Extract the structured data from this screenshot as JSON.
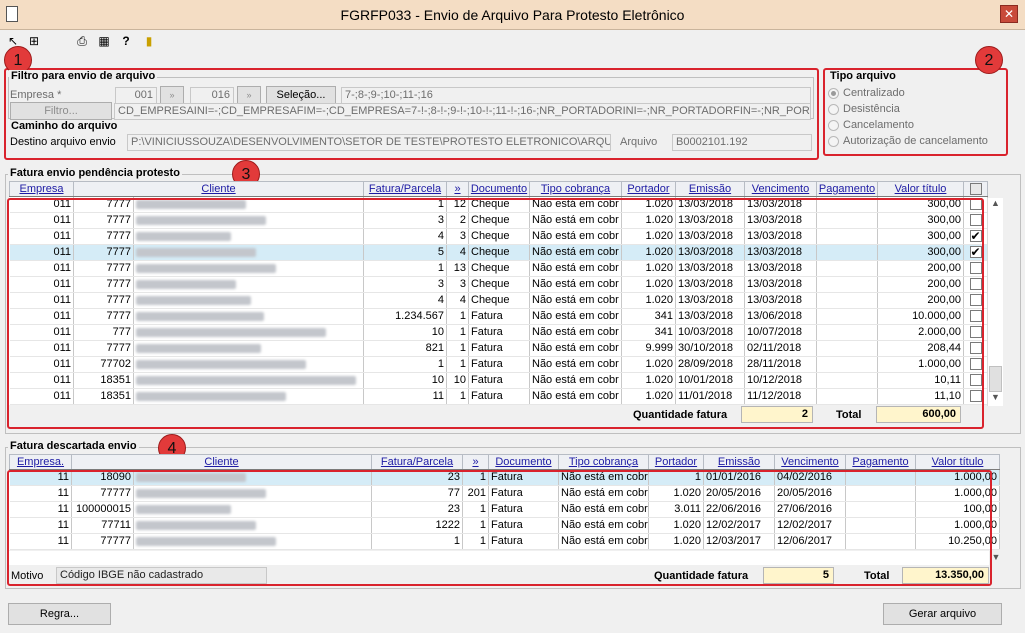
{
  "window": {
    "title": "FGRFP033 - Envio de Arquivo Para Protesto Eletrônico",
    "close_label": "✕"
  },
  "toolbar": {
    "icons": [
      "select-arrow-icon",
      "tree-icon",
      "print-icon",
      "grid-icon",
      "help-icon",
      "exit-door-icon"
    ]
  },
  "badges": [
    "1",
    "2",
    "3",
    "4"
  ],
  "filter": {
    "title": "Filtro para envio de arquivo",
    "empresa_label": "Empresa *",
    "empresa_from": "001",
    "empresa_to": "016",
    "selecao_button": "Seleção...",
    "selecao_value": "7-;8-;9-;10-;11-;16",
    "filtro_button": "Filtro...",
    "filtro_value": "CD_EMPRESAINI=-;CD_EMPRESAFIM=-;CD_EMPRESA=7-!-;8-!-;9-!-;10-!-;11-!-;16-;NR_PORTADORINI=-;NR_PORTADORFIN=-;NR_PORTADOR=-;NR_"
  },
  "path": {
    "title": "Caminho do arquivo",
    "destino_label": "Destino arquivo envio",
    "destino_value": "P:\\VINICIUSSOUZA\\DESENVOLVIMENTO\\SETOR DE TESTE\\PROTESTO ELETRONICO\\ARQUIVOS_GE",
    "arquivo_label": "Arquivo",
    "arquivo_value": "B0002101.192"
  },
  "tipo": {
    "title": "Tipo arquivo",
    "options": [
      "Centralizado",
      "Desistência",
      "Cancelamento",
      "Autorização de cancelamento"
    ],
    "selected": "Centralizado"
  },
  "pending": {
    "title": "Fatura envio pendência protesto",
    "headers": [
      "Empresa",
      "Cliente",
      "Fatura/Parcela",
      "»",
      "Documento",
      "Tipo cobrança",
      "Portador",
      "Emissão",
      "Vencimento",
      "Pagamento",
      "Valor título",
      ""
    ],
    "rows": [
      {
        "empresa": "011",
        "cliente": "7777",
        "fatura": "1",
        "parcela": "12",
        "documento": "Cheque",
        "tipo": "Não está em cobr",
        "portador": "1.020",
        "emissao": "13/03/2018",
        "vencimento": "13/03/2018",
        "pagamento": "",
        "valor": "300,00",
        "checked": false
      },
      {
        "empresa": "011",
        "cliente": "7777",
        "fatura": "3",
        "parcela": "2",
        "documento": "Cheque",
        "tipo": "Não está em cobr",
        "portador": "1.020",
        "emissao": "13/03/2018",
        "vencimento": "13/03/2018",
        "pagamento": "",
        "valor": "300,00",
        "checked": false
      },
      {
        "empresa": "011",
        "cliente": "7777",
        "fatura": "4",
        "parcela": "3",
        "documento": "Cheque",
        "tipo": "Não está em cobr",
        "portador": "1.020",
        "emissao": "13/03/2018",
        "vencimento": "13/03/2018",
        "pagamento": "",
        "valor": "300,00",
        "checked": true
      },
      {
        "empresa": "011",
        "cliente": "7777",
        "fatura": "5",
        "parcela": "4",
        "documento": "Cheque",
        "tipo": "Não está em cobr",
        "portador": "1.020",
        "emissao": "13/03/2018",
        "vencimento": "13/03/2018",
        "pagamento": "",
        "valor": "300,00",
        "checked": true,
        "selected": true
      },
      {
        "empresa": "011",
        "cliente": "7777",
        "fatura": "1",
        "parcela": "13",
        "documento": "Cheque",
        "tipo": "Não está em cobr",
        "portador": "1.020",
        "emissao": "13/03/2018",
        "vencimento": "13/03/2018",
        "pagamento": "",
        "valor": "200,00",
        "checked": false
      },
      {
        "empresa": "011",
        "cliente": "7777",
        "fatura": "3",
        "parcela": "3",
        "documento": "Cheque",
        "tipo": "Não está em cobr",
        "portador": "1.020",
        "emissao": "13/03/2018",
        "vencimento": "13/03/2018",
        "pagamento": "",
        "valor": "200,00",
        "checked": false
      },
      {
        "empresa": "011",
        "cliente": "7777",
        "fatura": "4",
        "parcela": "4",
        "documento": "Cheque",
        "tipo": "Não está em cobr",
        "portador": "1.020",
        "emissao": "13/03/2018",
        "vencimento": "13/03/2018",
        "pagamento": "",
        "valor": "200,00",
        "checked": false
      },
      {
        "empresa": "011",
        "cliente": "7777",
        "fatura": "1.234.567",
        "parcela": "1",
        "documento": "Fatura",
        "tipo": "Não está em cobr",
        "portador": "341",
        "emissao": "13/03/2018",
        "vencimento": "13/06/2018",
        "pagamento": "",
        "valor": "10.000,00",
        "checked": false
      },
      {
        "empresa": "011",
        "cliente": "777",
        "fatura": "10",
        "parcela": "1",
        "documento": "Fatura",
        "tipo": "Não está em cobr",
        "portador": "341",
        "emissao": "10/03/2018",
        "vencimento": "10/07/2018",
        "pagamento": "",
        "valor": "2.000,00",
        "checked": false
      },
      {
        "empresa": "011",
        "cliente": "7777",
        "fatura": "821",
        "parcela": "1",
        "documento": "Fatura",
        "tipo": "Não está em cobr",
        "portador": "9.999",
        "emissao": "30/10/2018",
        "vencimento": "02/11/2018",
        "pagamento": "",
        "valor": "208,44",
        "checked": false
      },
      {
        "empresa": "011",
        "cliente": "77702",
        "fatura": "1",
        "parcela": "1",
        "documento": "Fatura",
        "tipo": "Não está em cobr",
        "portador": "1.020",
        "emissao": "28/09/2018",
        "vencimento": "28/11/2018",
        "pagamento": "",
        "valor": "1.000,00",
        "checked": false
      },
      {
        "empresa": "011",
        "cliente": "18351",
        "fatura": "10",
        "parcela": "10",
        "documento": "Fatura",
        "tipo": "Não está em cobr",
        "portador": "1.020",
        "emissao": "10/01/2018",
        "vencimento": "10/12/2018",
        "pagamento": "",
        "valor": "10,11",
        "checked": false
      },
      {
        "empresa": "011",
        "cliente": "18351",
        "fatura": "11",
        "parcela": "1",
        "documento": "Fatura",
        "tipo": "Não está em cobr",
        "portador": "1.020",
        "emissao": "11/01/2018",
        "vencimento": "11/12/2018",
        "pagamento": "",
        "valor": "11,10",
        "checked": false
      }
    ],
    "qtd_label": "Quantidade fatura",
    "qtd_value": "2",
    "total_label": "Total",
    "total_value": "600,00"
  },
  "discarded": {
    "title": "Fatura descartada envio",
    "headers": [
      "Empresa.",
      "Cliente",
      "Fatura/Parcela",
      "»",
      "Documento",
      "Tipo cobrança",
      "Portador",
      "Emissão",
      "Vencimento",
      "Pagamento",
      "Valor título"
    ],
    "rows": [
      {
        "empresa": "11",
        "cliente": "18090",
        "fatura": "23",
        "parcela": "1",
        "documento": "Fatura",
        "tipo": "Não está em cobr",
        "portador": "1",
        "emissao": "01/01/2016",
        "vencimento": "04/02/2016",
        "pagamento": "",
        "valor": "1.000,00",
        "selected": true
      },
      {
        "empresa": "11",
        "cliente": "77777",
        "fatura": "77",
        "parcela": "201",
        "documento": "Fatura",
        "tipo": "Não está em cobr",
        "portador": "1.020",
        "emissao": "20/05/2016",
        "vencimento": "20/05/2016",
        "pagamento": "",
        "valor": "1.000,00"
      },
      {
        "empresa": "11",
        "cliente": "100000015",
        "fatura": "23",
        "parcela": "1",
        "documento": "Fatura",
        "tipo": "Não está em cobr",
        "portador": "3.011",
        "emissao": "22/06/2016",
        "vencimento": "27/06/2016",
        "pagamento": "",
        "valor": "100,00"
      },
      {
        "empresa": "11",
        "cliente": "77711",
        "fatura": "1222",
        "parcela": "1",
        "documento": "Fatura",
        "tipo": "Não está em cobr",
        "portador": "1.020",
        "emissao": "12/02/2017",
        "vencimento": "12/02/2017",
        "pagamento": "",
        "valor": "1.000,00"
      },
      {
        "empresa": "11",
        "cliente": "77777",
        "fatura": "1",
        "parcela": "1",
        "documento": "Fatura",
        "tipo": "Não está em cobr",
        "portador": "1.020",
        "emissao": "12/03/2017",
        "vencimento": "12/06/2017",
        "pagamento": "",
        "valor": "10.250,00"
      }
    ],
    "motivo_label": "Motivo",
    "motivo_value": "Código IBGE não cadastrado",
    "qtd_label": "Quantidade fatura",
    "qtd_value": "5",
    "total_label": "Total",
    "total_value": "13.350,00"
  },
  "footer": {
    "regra_button": "Regra...",
    "gerar_button": "Gerar arquivo"
  }
}
